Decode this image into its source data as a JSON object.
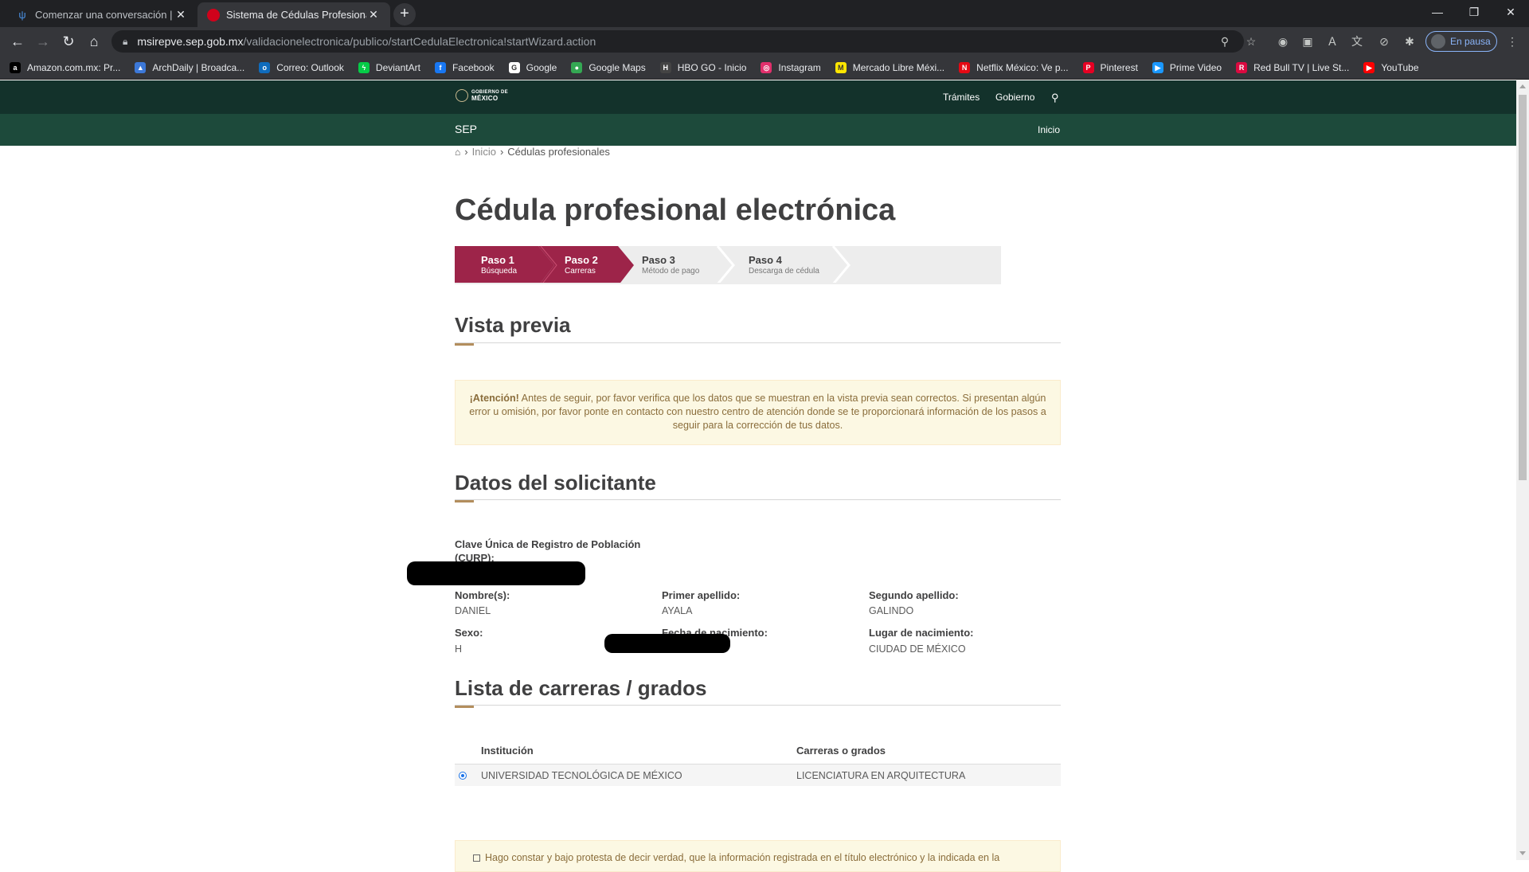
{
  "browser": {
    "tabs": [
      {
        "title": "Comenzar una conversación | Co",
        "icon": "fork-icon"
      },
      {
        "title": "Sistema de Cédulas Profesionales",
        "icon": "red-circle-icon"
      }
    ],
    "url_host": "msirepve.sep.gob.mx",
    "url_path": "/validacionelectronica/publico/startCedulaElectronica!startWizard.action",
    "profile_label": "En pausa",
    "bookmarks": [
      {
        "label": "Amazon.com.mx: Pr...",
        "color": "#000000",
        "glyph": "a"
      },
      {
        "label": "ArchDaily | Broadca...",
        "color": "#3c78d8",
        "glyph": "▲"
      },
      {
        "label": "Correo: Outlook",
        "color": "#0f6cbd",
        "glyph": "o"
      },
      {
        "label": "DeviantArt",
        "color": "#05cc47",
        "glyph": "ϟ"
      },
      {
        "label": "Facebook",
        "color": "#1877f2",
        "glyph": "f"
      },
      {
        "label": "Google",
        "color": "#ffffff",
        "glyph": "G"
      },
      {
        "label": "Google Maps",
        "color": "#34a853",
        "glyph": "●"
      },
      {
        "label": "HBO GO - Inicio",
        "color": "#444444",
        "glyph": "H"
      },
      {
        "label": "Instagram",
        "color": "#e1306c",
        "glyph": "◎"
      },
      {
        "label": "Mercado Libre Méxi...",
        "color": "#ffe600",
        "glyph": "M"
      },
      {
        "label": "Netflix México: Ve p...",
        "color": "#e50914",
        "glyph": "N"
      },
      {
        "label": "Pinterest",
        "color": "#e60023",
        "glyph": "P"
      },
      {
        "label": "Prime Video",
        "color": "#1a98ff",
        "glyph": "▶"
      },
      {
        "label": "Red Bull TV | Live St...",
        "color": "#db0a40",
        "glyph": "R"
      },
      {
        "label": "YouTube",
        "color": "#ff0000",
        "glyph": "▶"
      }
    ]
  },
  "site": {
    "logo_text_1": "GOBIERNO DE",
    "logo_text_2": "MÉXICO",
    "nav_tramites": "Trámites",
    "nav_gobierno": "Gobierno",
    "sub_label": "SEP",
    "sub_inicio": "Inicio"
  },
  "breadcrumb": {
    "sep": "›",
    "inicio": "Inicio",
    "current": "Cédulas profesionales"
  },
  "page_title": "Cédula profesional electrónica",
  "steps": [
    {
      "title": "Paso 1",
      "desc": "Búsqueda",
      "state": "done"
    },
    {
      "title": "Paso 2",
      "desc": "Carreras",
      "state": "active"
    },
    {
      "title": "Paso 3",
      "desc": "Método de pago",
      "state": "pending"
    },
    {
      "title": "Paso 4",
      "desc": "Descarga de cédula",
      "state": "pending"
    }
  ],
  "colors": {
    "step_active": "#9d2449",
    "header_dark": "#13322b",
    "header_sub": "#1d4a3b",
    "accent": "#b38e5d"
  },
  "preview": {
    "title": "Vista previa",
    "alert_strong": "¡Atención!",
    "alert_text": " Antes de seguir, por favor verifica que los datos que se muestran en la vista previa sean correctos. Si presentan algún error u omisión, por favor ponte en contacto con nuestro centro de atención donde se te proporcionará información de los pasos a seguir para la corrección de tus datos."
  },
  "applicant": {
    "title": "Datos del solicitante",
    "curp_label": "Clave Única de Registro de Población (CURP):",
    "nombre_label": "Nombre(s):",
    "nombre_value": "DANIEL",
    "primer_label": "Primer apellido:",
    "primer_value": "AYALA",
    "segundo_label": "Segundo apellido:",
    "segundo_value": "GALINDO",
    "sexo_label": "Sexo:",
    "sexo_value": "H",
    "fecha_label": "Fecha de nacimiento:",
    "lugar_label": "Lugar de nacimiento:",
    "lugar_value": "CIUDAD DE MÉXICO"
  },
  "careers": {
    "title": "Lista de carreras / grados",
    "col_institution": "Institución",
    "col_career": "Carreras o grados",
    "rows": [
      {
        "institution": "UNIVERSIDAD TECNOLÓGICA DE MÉXICO",
        "career": "LICENCIATURA EN ARQUITECTURA",
        "selected": true
      }
    ]
  },
  "declaration_text": "Hago constar y bajo protesta de decir verdad, que la información registrada en el título electrónico y la indicada en la"
}
